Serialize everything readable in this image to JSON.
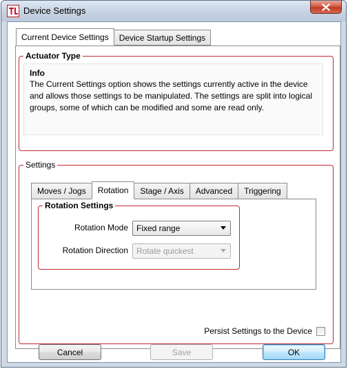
{
  "window": {
    "title": "Device Settings",
    "close_glyph": "X"
  },
  "main_tabs": [
    {
      "label": "Current Device Settings",
      "active": true
    },
    {
      "label": "Device Startup Settings",
      "active": false
    }
  ],
  "actuator_group": {
    "legend": "Actuator Type",
    "info_title": "Info",
    "info_text": "The Current Settings option shows the settings currently active in the device and allows those settings to be manipulated. The settings are split into logical groups, some of which can be modified and some are read only."
  },
  "settings_group": {
    "legend": "Settings",
    "tabs": [
      {
        "label": "Moves / Jogs",
        "active": false
      },
      {
        "label": "Rotation",
        "active": true
      },
      {
        "label": "Stage / Axis",
        "active": false
      },
      {
        "label": "Advanced",
        "active": false
      },
      {
        "label": "Triggering",
        "active": false
      }
    ],
    "rotation": {
      "legend": "Rotation Settings",
      "mode_label": "Rotation Mode",
      "mode_value": "Fixed range",
      "direction_label": "Rotation Direction",
      "direction_value": "Rotate quickest"
    },
    "persist_label": "Persist Settings to the Device",
    "persist_checked": false
  },
  "buttons": {
    "cancel": "Cancel",
    "save": "Save",
    "ok": "OK"
  },
  "colors": {
    "group_border": "#c0272d",
    "title_bar": "#c6d3e3",
    "close_button": "#c13a25"
  },
  "icons": {
    "app": "thorlabs-logo-icon",
    "close": "close-icon",
    "dropdown": "chevron-down-icon"
  }
}
